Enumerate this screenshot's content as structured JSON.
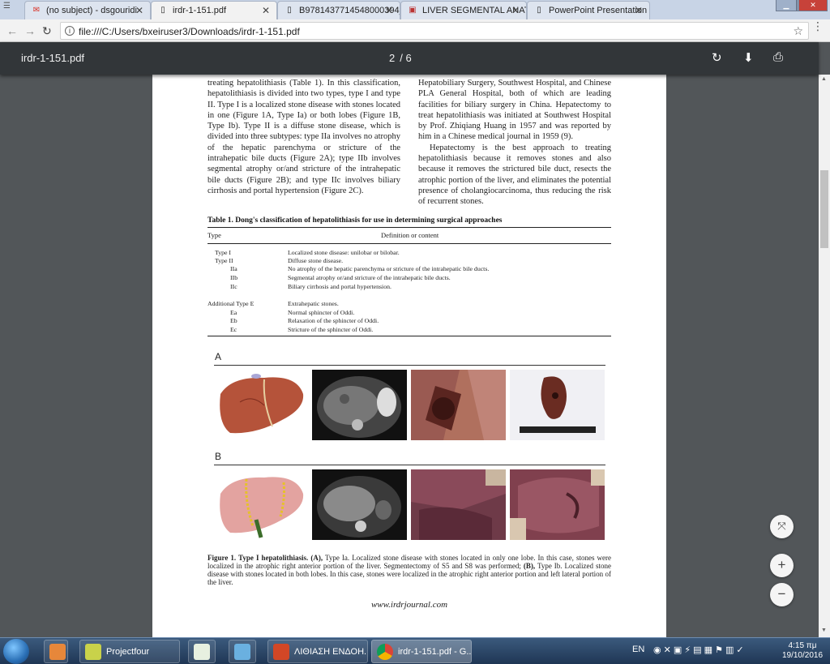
{
  "browser": {
    "tabs": [
      {
        "label": "(no subject) - dsgouridi",
        "icon": "gmail-icon"
      },
      {
        "label": "irdr-1-151.pdf",
        "icon": "document-icon"
      },
      {
        "label": "B9781437714548000394_f",
        "icon": "document-icon"
      },
      {
        "label": "LIVER SEGMENTAL ANAT",
        "icon": "image-icon"
      },
      {
        "label": "PowerPoint Presentation",
        "icon": "document-icon"
      }
    ],
    "url": "file:///C:/Users/bxeiruser3/Downloads/irdr-1-151.pdf"
  },
  "pdf_toolbar": {
    "filename": "irdr-1-151.pdf",
    "current_page": "2",
    "page_separator": "/",
    "total_pages": "6"
  },
  "document": {
    "left_column": "treating hepatolithiasis (Table 1). In this classification, hepatolithiasis is divided into two types, type I and type II. Type I is a localized stone disease with stones located in one (Figure 1A, Type Ia) or both lobes (Figure 1B, Type Ib). Type II is a diffuse stone disease, which is divided into three subtypes: type IIa involves no atrophy of the hepatic parenchyma or stricture of the intrahepatic bile ducts (Figure 2A); type IIb involves segmental atrophy or/and stricture of the intrahepatic bile ducts (Figure 2B); and type IIc involves biliary cirrhosis and portal hypertension (Figure 2C).",
    "right_column_p1": "Hepatobiliary Surgery, Southwest Hospital, and Chinese PLA General Hospital, both of which are leading facilities for biliary surgery in China. Hepatectomy to treat hepatolithiasis was initiated at Southwest Hospital by Prof. Zhiqiang Huang in 1957 and was reported by him in a Chinese medical journal in 1959 (9).",
    "right_column_p2": "Hepatectomy is the best approach to treating hepatolithiasis because it removes stones and also because it removes the strictured bile duct, resects the atrophic portion of the liver, and eliminates the potential presence of cholangiocarcinoma, thus reducing the risk of recurrent stones.",
    "table": {
      "title": "Table 1. Dong's classification of hepatolithiasis for use in determining surgical approaches",
      "col_type": "Type",
      "col_def": "Definition or content",
      "rows": [
        {
          "type": "Type I",
          "def": "Localized stone disease: unilobar or bilobar."
        },
        {
          "type": "Type II",
          "def": "Diffuse stone disease."
        },
        {
          "type": "IIa",
          "def": "No atrophy of the hepatic parenchyma or stricture of the intrahepatic bile ducts."
        },
        {
          "type": "IIb",
          "def": "Segmental atrophy or/and stricture of the intrahepatic bile ducts."
        },
        {
          "type": "IIc",
          "def": "Biliary cirrhosis and portal hypertension."
        },
        {
          "type": "Additional Type E",
          "def": "Extrahepatic stones."
        },
        {
          "type": "Ea",
          "def": "Normal sphincter of Oddi."
        },
        {
          "type": "Eb",
          "def": "Relaxation of the sphincter of Oddi."
        },
        {
          "type": "Ec",
          "def": "Stricture of the sphincter of Oddi."
        }
      ]
    },
    "figure": {
      "label_a": "A",
      "label_b": "B",
      "caption_bold": "Figure 1. Type I hepatolithiasis. (A),",
      "caption_1": " Type Ia. Localized stone disease with stones located in only one lobe. In this case, stones were localized in the atrophic right anterior portion of the liver. Segmentectomy of S5 and S8 was performed; ",
      "caption_bold2": "(B),",
      "caption_2": " Type Ib. Localized stone disease with stones located in both lobes. In this case, stones were localized in the atrophic right anterior portion and left lateral portion of the liver."
    },
    "footer_url": "www.irdrjournal.com"
  },
  "taskbar": {
    "items": [
      {
        "label": "Projectfour"
      },
      {
        "label": ""
      },
      {
        "label": ""
      },
      {
        "label": "ΛΙΘΙΑΣΗ ΕΝΔΟΗ..."
      },
      {
        "label": "irdr-1-151.pdf - G..."
      }
    ],
    "language": "EN",
    "time": "4:15 πμ",
    "date": "19/10/2016"
  }
}
